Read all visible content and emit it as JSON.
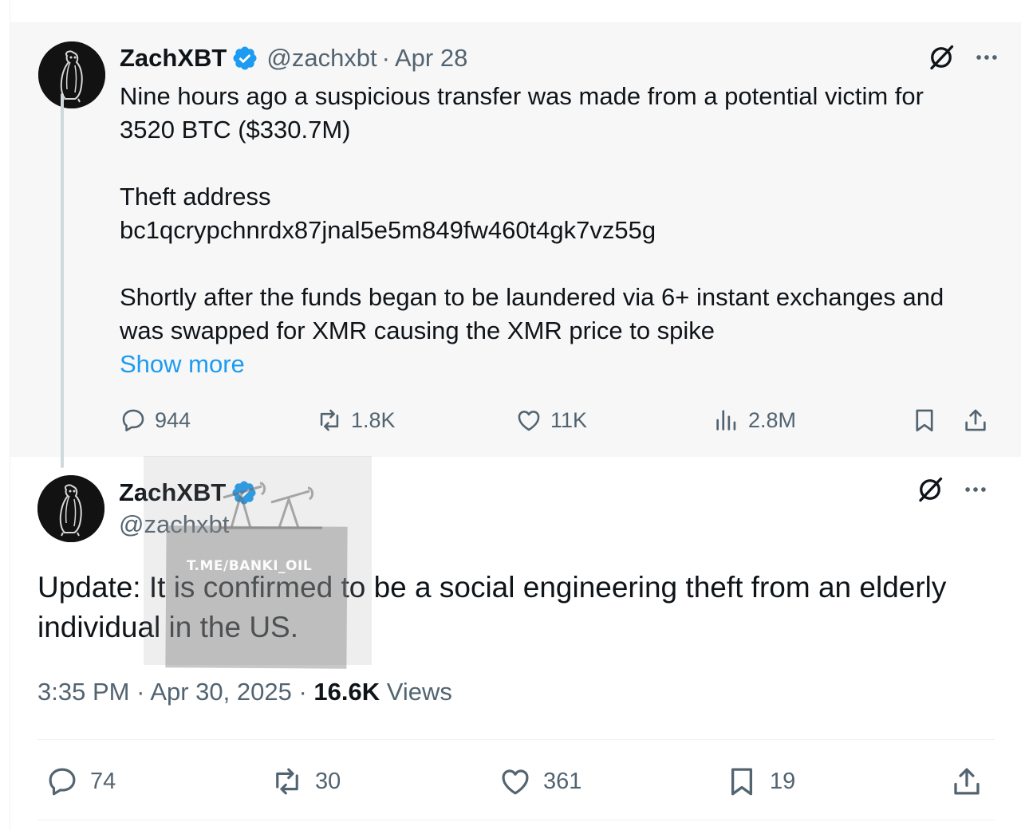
{
  "parent_tweet": {
    "author_name": "ZachXBT",
    "handle": "@zachxbt",
    "separator": "·",
    "date": "Apr 28",
    "lines": [
      "Nine hours ago a suspicious transfer was made from a potential victim for",
      "3520 BTC ($330.7M)",
      "Theft address",
      "bc1qcrypchnrdx87jnal5e5m849fw460t4gk7vz55g",
      "Shortly after the funds began to be laundered via 6+ instant exchanges and",
      "was swapped for XMR causing the XMR price to spike"
    ],
    "show_more": "Show more",
    "stats": {
      "replies": "944",
      "reposts": "1.8K",
      "likes": "11K",
      "views": "2.8M"
    }
  },
  "main_tweet": {
    "author_name": "ZachXBT",
    "handle": "@zachxbt",
    "text_line1": "Update: It is confirmed to be a social engineering theft from an elderly",
    "text_line2": "individual in the US.",
    "time": "3:35 PM",
    "sep1": "·",
    "date": "Apr 30, 2025",
    "sep2": "·",
    "views_count": "16.6K",
    "views_label": "Views",
    "stats": {
      "replies": "74",
      "reposts": "30",
      "likes": "361",
      "bookmarks": "19"
    }
  },
  "watermark": {
    "text": "T.ME/BANKI_OIL"
  },
  "colors": {
    "verified": "#1d9bf0",
    "link": "#1d9bf0",
    "muted": "#536471",
    "parent_bg": "#f7f7f7"
  },
  "icons": [
    "verified-badge-icon",
    "grok-icon",
    "more-icon",
    "reply-icon",
    "repost-icon",
    "like-icon",
    "views-icon",
    "bookmark-icon",
    "share-icon"
  ]
}
